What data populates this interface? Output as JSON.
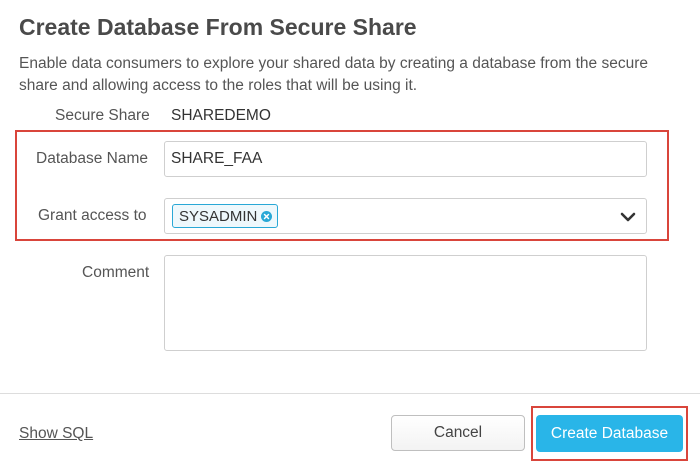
{
  "dialog": {
    "title": "Create Database From Secure Share",
    "description": "Enable data consumers to explore your shared data by creating a database from the secure share and allowing access to the roles that will be using it."
  },
  "form": {
    "secure_share": {
      "label": "Secure Share",
      "value": "SHAREDEMO"
    },
    "database_name": {
      "label": "Database Name",
      "value": "SHARE_FAA"
    },
    "grant_access": {
      "label": "Grant access to",
      "tags": [
        "SYSADMIN"
      ],
      "remove_icon": "close-circle-icon",
      "dropdown_icon": "chevron-down-icon"
    },
    "comment": {
      "label": "Comment",
      "value": ""
    }
  },
  "footer": {
    "show_sql_label": "Show SQL",
    "cancel_label": "Cancel",
    "create_label": "Create Database"
  },
  "colors": {
    "accent": "#29b5e8",
    "highlight_border": "#d9453b",
    "tag_border": "#29a8d6"
  }
}
